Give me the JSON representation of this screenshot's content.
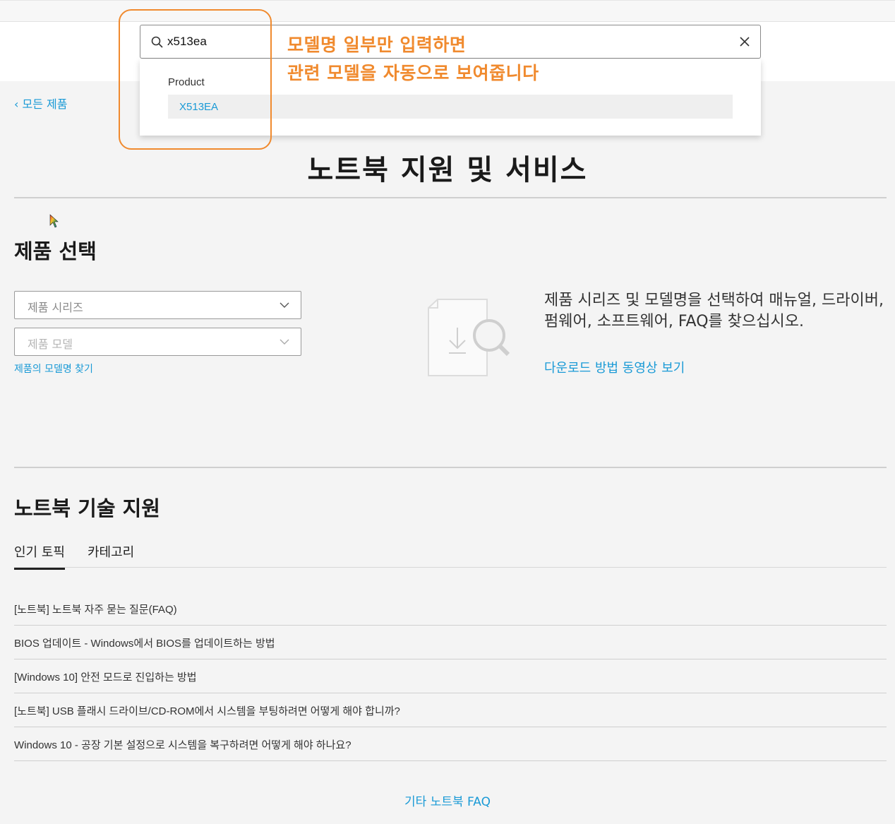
{
  "search": {
    "value": "x513ea",
    "dropdown_heading": "Product",
    "suggestion": "X513EA"
  },
  "annotation": {
    "line1": "모델명 일부만 입력하면",
    "line2": "관련 모델을 자동으로 보여줍니다",
    "color": "#f08a2e"
  },
  "nav": {
    "back_label": "모든 제품"
  },
  "page_title": "노트북 지원 및 서비스",
  "product_select": {
    "title": "제품 선택",
    "series_placeholder": "제품 시리즈",
    "model_placeholder": "제품 모델",
    "find_model_link": "제품의 모델명 찾기",
    "promo_text": "제품 시리즈 및 모델명을 선택하여 매뉴얼, 드라이버, 펌웨어, 소프트웨어, FAQ를 찾으십시오.",
    "promo_link": "다운로드 방법 동영상 보기"
  },
  "tech_support": {
    "title": "노트북 기술 지원",
    "tabs": [
      {
        "label": "인기 토픽"
      },
      {
        "label": "카테고리"
      }
    ],
    "topics": [
      {
        "text": "[노트북] 노트북 자주 묻는 질문(FAQ)"
      },
      {
        "text": "BIOS 업데이트 - Windows에서 BIOS를 업데이트하는 방법"
      },
      {
        "text": "[Windows 10] 안전 모드로 진입하는 방법"
      },
      {
        "text": "[노트북] USB 플래시 드라이브/CD-ROM에서 시스템을 부팅하려면 어떻게 해야 합니까?"
      },
      {
        "text": "Windows 10 - 공장 기본 설정으로 시스템을 복구하려면 어떻게 해야 하나요?"
      }
    ],
    "more_link": "기타 노트북 FAQ"
  },
  "colors": {
    "link": "#1a9ad6",
    "background": "#f4f4f4",
    "annotation": "#f08a2e"
  }
}
